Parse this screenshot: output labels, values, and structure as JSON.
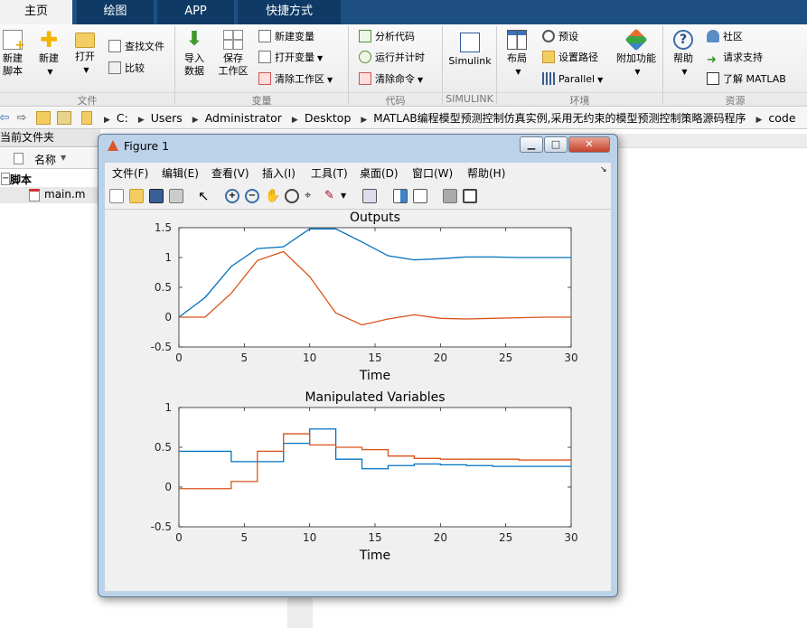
{
  "tabs": [
    {
      "label": "主页"
    },
    {
      "label": "绘图"
    },
    {
      "label": "APP"
    },
    {
      "label": "快捷方式"
    }
  ],
  "ribbon": {
    "file": {
      "new_script": "新建\n脚本",
      "new": "新建",
      "open": "打开",
      "find_files": "查找文件",
      "compare": "比较",
      "group": "文件"
    },
    "variable": {
      "import": "导入\n数据",
      "save_ws": "保存\n工作区",
      "new_var": "新建变量",
      "open_var": "打开变量",
      "clear_ws": "清除工作区",
      "group": "变量"
    },
    "code": {
      "analyze": "分析代码",
      "run_time": "运行并计时",
      "clear_cmd": "清除命令",
      "group": "代码"
    },
    "simulink": {
      "label": "Simulink",
      "group": "SIMULINK"
    },
    "env": {
      "layout": "布局",
      "prefs": "预设",
      "set_path": "设置路径",
      "parallel": "Parallel",
      "addons": "附加功能",
      "group": "环境"
    },
    "resources": {
      "help": "帮助",
      "community": "社区",
      "support": "请求支持",
      "learn": "了解 MATLAB",
      "group": "资源"
    }
  },
  "address": [
    "C:",
    "Users",
    "Administrator",
    "Desktop",
    "MATLAB编程模型预测控制仿真实例,采用无约束的模型预测控制策略源码程序",
    "code"
  ],
  "left_panel": {
    "title": "当前文件夹",
    "column": "名称",
    "folder": "脚本",
    "file": "main.m"
  },
  "figure": {
    "title": "Figure 1",
    "menus": [
      "文件(F)",
      "编辑(E)",
      "查看(V)",
      "插入(I)",
      "工具(T)",
      "桌面(D)",
      "窗口(W)",
      "帮助(H)"
    ]
  },
  "chart_data": [
    {
      "type": "line",
      "title": "Outputs",
      "xlabel": "Time",
      "ylabel": "",
      "xlim": [
        0,
        30
      ],
      "ylim": [
        -0.5,
        1.5
      ],
      "xticks": [
        0,
        5,
        10,
        15,
        20,
        25,
        30
      ],
      "yticks": [
        -0.5,
        0,
        0.5,
        1,
        1.5
      ],
      "series": [
        {
          "color": "#0072bd",
          "x": [
            0,
            2,
            4,
            6,
            8,
            10,
            12,
            14,
            16,
            18,
            20,
            22,
            24,
            26,
            28,
            30
          ],
          "y": [
            0,
            0.33,
            0.85,
            1.15,
            1.18,
            1.48,
            1.48,
            1.26,
            1.03,
            0.96,
            0.98,
            1.01,
            1.01,
            1.0,
            1.0,
            1.0
          ]
        },
        {
          "color": "#d95319",
          "x": [
            0,
            2,
            4,
            6,
            8,
            10,
            12,
            14,
            16,
            18,
            20,
            22,
            24,
            26,
            28,
            30
          ],
          "y": [
            0,
            0,
            0.4,
            0.95,
            1.1,
            0.68,
            0.07,
            -0.13,
            -0.03,
            0.04,
            -0.02,
            -0.03,
            -0.02,
            -0.01,
            0,
            0
          ]
        }
      ]
    },
    {
      "type": "line",
      "step": true,
      "title": "Manipulated Variables",
      "xlabel": "Time",
      "ylabel": "",
      "xlim": [
        0,
        30
      ],
      "ylim": [
        -0.5,
        1
      ],
      "xticks": [
        0,
        5,
        10,
        15,
        20,
        25,
        30
      ],
      "yticks": [
        -0.5,
        0,
        0.5,
        1
      ],
      "series": [
        {
          "color": "#0072bd",
          "x": [
            0,
            2,
            4,
            6,
            8,
            10,
            12,
            14,
            16,
            18,
            20,
            22,
            24,
            26,
            28,
            30
          ],
          "y": [
            0.45,
            0.45,
            0.32,
            0.32,
            0.55,
            0.73,
            0.35,
            0.23,
            0.27,
            0.29,
            0.28,
            0.27,
            0.26,
            0.26,
            0.26,
            0.26
          ]
        },
        {
          "color": "#d95319",
          "x": [
            0,
            2,
            4,
            6,
            8,
            10,
            12,
            14,
            16,
            18,
            20,
            22,
            24,
            26,
            28,
            30
          ],
          "y": [
            -0.02,
            -0.02,
            0.07,
            0.45,
            0.67,
            0.53,
            0.5,
            0.47,
            0.39,
            0.36,
            0.35,
            0.35,
            0.35,
            0.34,
            0.34,
            0.34
          ]
        }
      ]
    }
  ]
}
